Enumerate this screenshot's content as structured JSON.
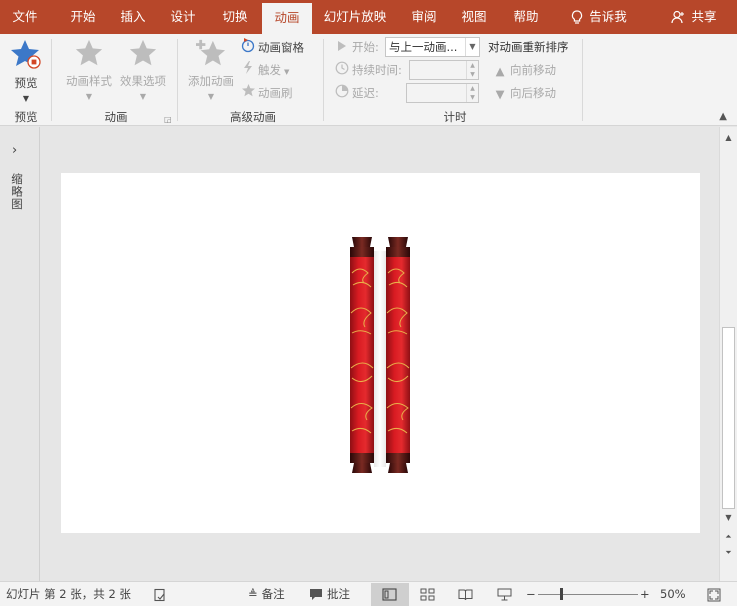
{
  "tabs": [
    {
      "label": "文件",
      "active": false
    },
    {
      "label": "开始",
      "active": false
    },
    {
      "label": "插入",
      "active": false
    },
    {
      "label": "设计",
      "active": false
    },
    {
      "label": "切换",
      "active": false
    },
    {
      "label": "动画",
      "active": true
    },
    {
      "label": "幻灯片放映",
      "active": false
    },
    {
      "label": "审阅",
      "active": false
    },
    {
      "label": "视图",
      "active": false
    },
    {
      "label": "帮助",
      "active": false
    }
  ],
  "tell_me": "告诉我",
  "share": "共享",
  "ribbon": {
    "preview": {
      "button": "预览",
      "group": "预览"
    },
    "animation": {
      "style_button": "动画样式",
      "options_button": "效果选项",
      "group": "动画"
    },
    "advanced": {
      "add_button": "添加动画",
      "pane_button": "动画窗格",
      "trigger_button": "触发",
      "painter_button": "动画刷",
      "group": "高级动画"
    },
    "timing": {
      "start_label": "开始:",
      "start_value": "与上一动画...",
      "duration_label": "持续时间:",
      "delay_label": "延迟:",
      "reorder_title": "对动画重新排序",
      "move_earlier": "向前移动",
      "move_later": "向后移动",
      "group": "计时"
    }
  },
  "thumbnail_pane_label": "缩略图",
  "status": {
    "slide_info": "幻灯片 第 2 张，共 2 张",
    "notes": "备注",
    "comments": "批注",
    "zoom_minus": "−",
    "zoom_plus": "+",
    "zoom_level": "50%"
  },
  "colors": {
    "accent": "#b7472a",
    "scroll_red": "#c8161d",
    "scroll_gold": "#e8b04a",
    "rod_dark": "#3a0d0d"
  }
}
